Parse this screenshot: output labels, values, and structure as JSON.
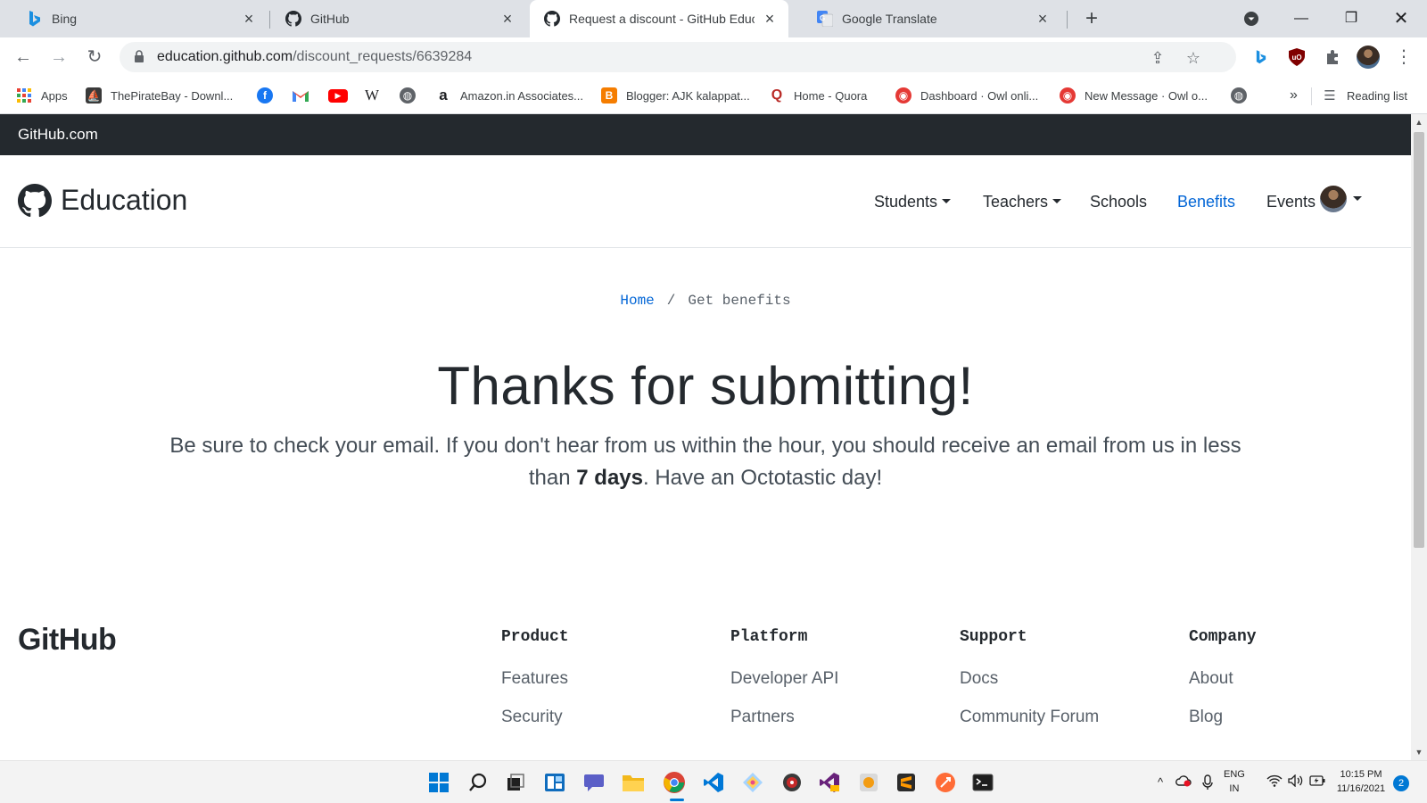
{
  "browser": {
    "tabs": [
      {
        "title": "Bing",
        "icon": "bing-icon"
      },
      {
        "title": "GitHub",
        "icon": "github-icon"
      },
      {
        "title": "Request a discount - GitHub Educati",
        "icon": "github-icon",
        "active": true
      },
      {
        "title": "Google Translate",
        "icon": "google-translate-icon"
      }
    ],
    "address": {
      "host": "education.github.com",
      "path": "/discount_requests/6639284"
    },
    "bookmarks": [
      {
        "label": "Apps",
        "icon": "apps-grid-icon"
      },
      {
        "label": "ThePirateBay - Downl...",
        "icon": "pirate-ship-icon"
      },
      {
        "label": "",
        "icon": "facebook-icon"
      },
      {
        "label": "",
        "icon": "gmail-icon"
      },
      {
        "label": "",
        "icon": "youtube-icon"
      },
      {
        "label": "",
        "icon": "wikipedia-icon"
      },
      {
        "label": "",
        "icon": "globe-icon"
      },
      {
        "label": "Amazon.in Associates...",
        "icon": "amazon-icon"
      },
      {
        "label": "Blogger: AJK kalappat...",
        "icon": "blogger-icon"
      },
      {
        "label": "Home - Quora",
        "icon": "quora-icon"
      },
      {
        "label": "Dashboard · Owl onli...",
        "icon": "owl-icon"
      },
      {
        "label": "New Message · Owl o...",
        "icon": "owl-icon"
      },
      {
        "label": "",
        "icon": "globe-icon"
      }
    ],
    "more_bookmarks": "»",
    "reading_list": "Reading list"
  },
  "page": {
    "github_link": "GitHub.com",
    "brand": "Education",
    "nav": {
      "students": "Students",
      "teachers": "Teachers",
      "schools": "Schools",
      "benefits": "Benefits",
      "events": "Events"
    },
    "breadcrumb": {
      "home": "Home",
      "separator": "/",
      "current": "Get benefits"
    },
    "heading": "Thanks for submitting!",
    "lead_before": "Be sure to check your email. If you don't hear from us within the hour, you should receive an email from us in less than ",
    "lead_bold": "7 days",
    "lead_after": ". Have an Octotastic day!",
    "footer": {
      "brand": "GitHub",
      "columns": [
        {
          "heading": "Product",
          "links": [
            "Features",
            "Security"
          ]
        },
        {
          "heading": "Platform",
          "links": [
            "Developer API",
            "Partners"
          ]
        },
        {
          "heading": "Support",
          "links": [
            "Docs",
            "Community Forum"
          ]
        },
        {
          "heading": "Company",
          "links": [
            "About",
            "Blog"
          ]
        }
      ]
    }
  },
  "taskbar": {
    "language_line1": "ENG",
    "language_line2": "IN",
    "time": "10:15 PM",
    "date": "11/16/2021",
    "notifications": "2"
  },
  "colors": {
    "link_blue": "#0366d6",
    "header_dark": "#24292e"
  }
}
